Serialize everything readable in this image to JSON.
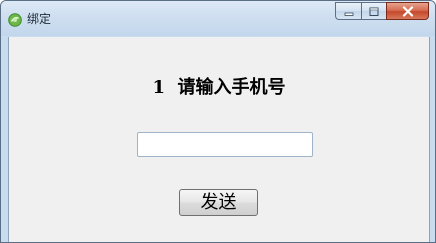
{
  "window": {
    "title": "绑定",
    "icon": "green-circle-app-icon",
    "controls": {
      "minimize_icon": "minimize-icon",
      "maximize_icon": "maximize-icon",
      "close_icon": "close-icon"
    }
  },
  "form": {
    "prompt": "1  请输入手机号",
    "phone_input": {
      "value": "",
      "placeholder": ""
    },
    "send_button_label": "发送"
  },
  "colors": {
    "client_background": "#f0f0f0",
    "close_button_red": "#c44a2c",
    "titlebar_blue": "#cfdff0"
  }
}
